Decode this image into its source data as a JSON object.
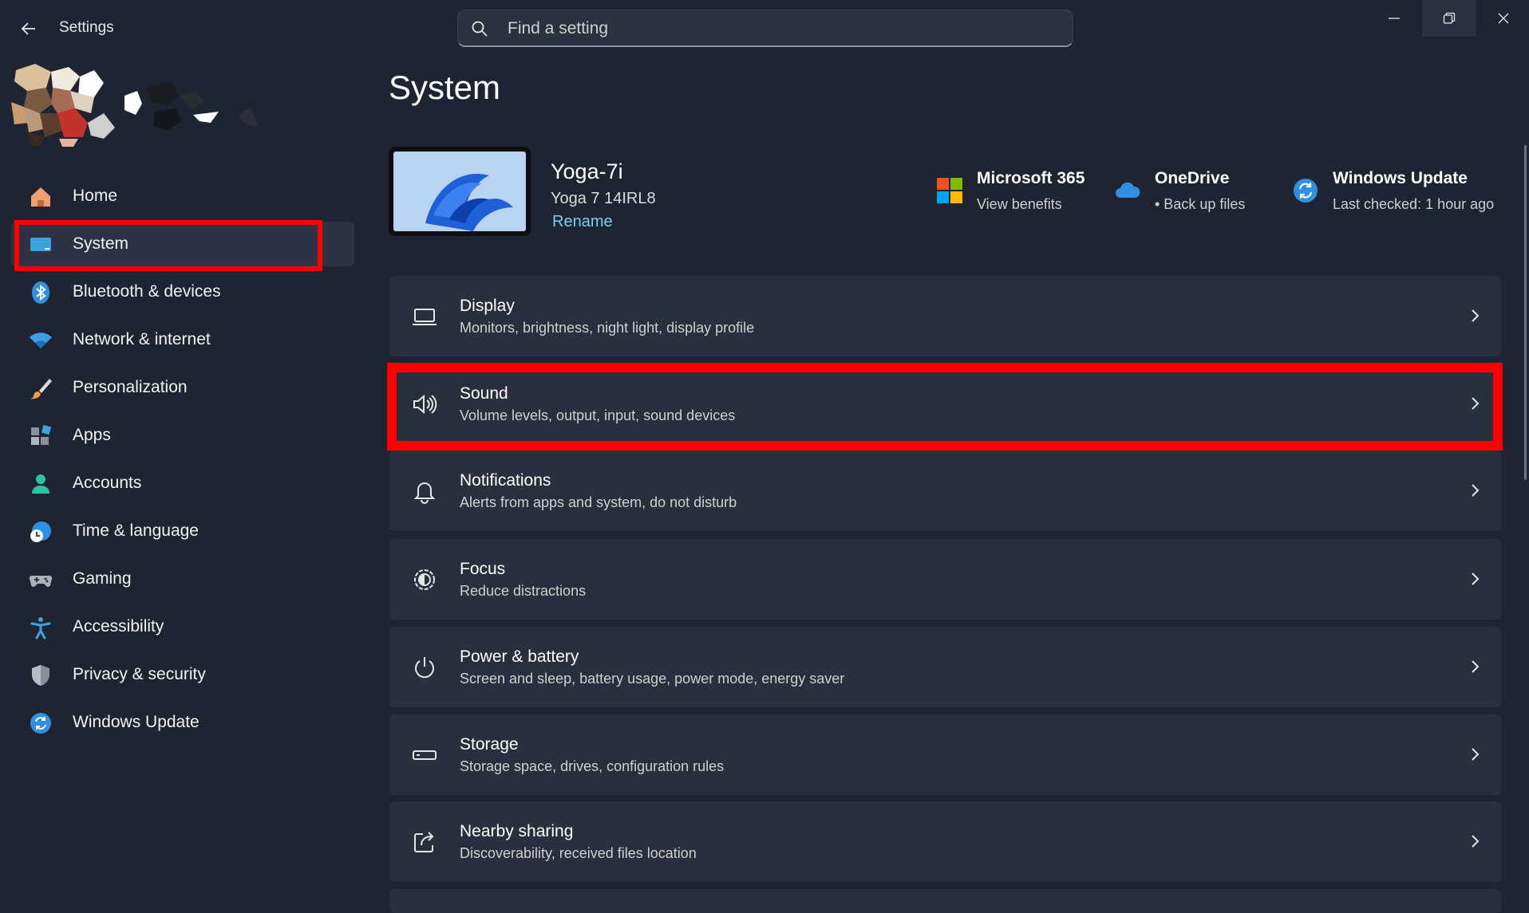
{
  "window": {
    "app_title": "Settings",
    "search_placeholder": "Find a setting"
  },
  "sidebar": {
    "items": [
      {
        "label": "Home",
        "icon": "home-icon"
      },
      {
        "label": "System",
        "icon": "system-monitor-icon",
        "selected": true
      },
      {
        "label": "Bluetooth & devices",
        "icon": "bluetooth-icon"
      },
      {
        "label": "Network & internet",
        "icon": "wifi-icon"
      },
      {
        "label": "Personalization",
        "icon": "paintbrush-icon"
      },
      {
        "label": "Apps",
        "icon": "apps-icon"
      },
      {
        "label": "Accounts",
        "icon": "account-icon"
      },
      {
        "label": "Time & language",
        "icon": "globe-clock-icon"
      },
      {
        "label": "Gaming",
        "icon": "gamepad-icon"
      },
      {
        "label": "Accessibility",
        "icon": "accessibility-icon"
      },
      {
        "label": "Privacy & security",
        "icon": "shield-icon"
      },
      {
        "label": "Windows Update",
        "icon": "update-icon"
      }
    ]
  },
  "main": {
    "title": "System",
    "device": {
      "name": "Yoga-7i",
      "model": "Yoga 7 14IRL8",
      "rename": "Rename"
    },
    "quick_links": [
      {
        "title": "Microsoft 365",
        "subtitle": "View benefits",
        "icon": "microsoft-365-icon"
      },
      {
        "title": "OneDrive",
        "subtitle": "• Back up files",
        "icon": "onedrive-cloud-icon"
      },
      {
        "title": "Windows Update",
        "subtitle": "Last checked: 1 hour ago",
        "icon": "windows-update-icon"
      }
    ],
    "settings": [
      {
        "title": "Display",
        "subtitle": "Monitors, brightness, night light, display profile",
        "icon": "display-icon"
      },
      {
        "title": "Sound",
        "subtitle": "Volume levels, output, input, sound devices",
        "icon": "speaker-icon"
      },
      {
        "title": "Notifications",
        "subtitle": "Alerts from apps and system, do not disturb",
        "icon": "bell-icon"
      },
      {
        "title": "Focus",
        "subtitle": "Reduce distractions",
        "icon": "focus-icon"
      },
      {
        "title": "Power & battery",
        "subtitle": "Screen and sleep, battery usage, power mode, energy saver",
        "icon": "power-icon"
      },
      {
        "title": "Storage",
        "subtitle": "Storage space, drives, configuration rules",
        "icon": "storage-icon"
      },
      {
        "title": "Nearby sharing",
        "subtitle": "Discoverability, received files location",
        "icon": "share-icon"
      }
    ]
  },
  "colors": {
    "background": "#1f2433",
    "card": "#2a2f3d",
    "accent": "#7dcff0",
    "highlight": "#ff0000"
  }
}
